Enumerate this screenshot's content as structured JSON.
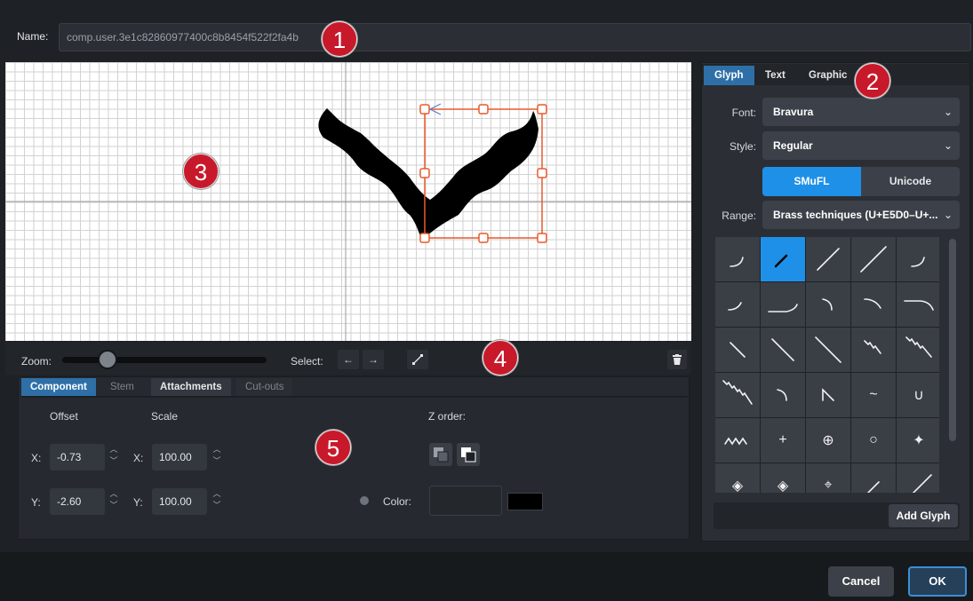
{
  "name": {
    "label": "Name:",
    "value": "comp.user.3e1c82860977400c8b8454f522f2fa4b"
  },
  "zoom": {
    "label": "Zoom:",
    "level": 0.22
  },
  "select": {
    "label": "Select:",
    "prev": "←",
    "next": "→"
  },
  "component_tabs": [
    "Component",
    "Stem",
    "Attachments",
    "Cut-outs"
  ],
  "offset": {
    "title": "Offset",
    "x_label": "X:",
    "x": "-0.73",
    "y_label": "Y:",
    "y": "-2.60"
  },
  "scale": {
    "title": "Scale",
    "x_label": "X:",
    "x": "100.00",
    "y_label": "Y:",
    "y": "100.00"
  },
  "zorder": {
    "label": "Z order:"
  },
  "color": {
    "label": "Color:",
    "value": "#000000"
  },
  "right_tabs": [
    "Glyph",
    "Text",
    "Graphic"
  ],
  "font": {
    "label": "Font:",
    "value": "Bravura"
  },
  "style": {
    "label": "Style:",
    "value": "Regular"
  },
  "encoding": {
    "smufl": "SMuFL",
    "unicode": "Unicode"
  },
  "range": {
    "label": "Range:",
    "value": "Brass techniques (U+E5D0–U+..."
  },
  "add_glyph": "Add Glyph",
  "buttons": {
    "cancel": "Cancel",
    "ok": "OK"
  },
  "callouts": [
    "1",
    "2",
    "3",
    "4",
    "5"
  ],
  "glyph_cells": [
    {
      "icon": "scoop-icon",
      "glyph": ""
    },
    {
      "icon": "doit-short-icon",
      "glyph": "",
      "selected": true
    },
    {
      "icon": "doit-medium-icon",
      "glyph": ""
    },
    {
      "icon": "doit-long-icon",
      "glyph": ""
    },
    {
      "icon": "lift-short-icon",
      "glyph": ""
    },
    {
      "icon": "lift-icon",
      "glyph": ""
    },
    {
      "icon": "lift-long-icon",
      "glyph": ""
    },
    {
      "icon": "plop-icon",
      "glyph": ""
    },
    {
      "icon": "falloff-icon",
      "glyph": ""
    },
    {
      "icon": "falloff-long-icon",
      "glyph": ""
    },
    {
      "icon": "fall-short-icon",
      "glyph": ""
    },
    {
      "icon": "fall-medium-icon",
      "glyph": ""
    },
    {
      "icon": "fall-long-icon",
      "glyph": ""
    },
    {
      "icon": "fall-rough-icon",
      "glyph": ""
    },
    {
      "icon": "fall-rough-long-icon",
      "glyph": ""
    },
    {
      "icon": "fall-rough-xlong-icon",
      "glyph": ""
    },
    {
      "icon": "bend-icon",
      "glyph": ""
    },
    {
      "icon": "flip-icon",
      "glyph": ""
    },
    {
      "icon": "smear-icon",
      "glyph": "~"
    },
    {
      "icon": "mute-bowl-icon",
      "glyph": "∪"
    },
    {
      "icon": "shake-icon",
      "glyph": ""
    },
    {
      "icon": "plus-icon",
      "glyph": "+"
    },
    {
      "icon": "half-mute-icon",
      "glyph": "⊕"
    },
    {
      "icon": "open-circle-icon",
      "glyph": "○"
    },
    {
      "icon": "harmon-icon",
      "glyph": "✦"
    },
    {
      "icon": "harmon-closed-icon",
      "glyph": "◈"
    },
    {
      "icon": "harmon-half-icon",
      "glyph": "◈"
    },
    {
      "icon": "harmon-open-icon",
      "glyph": "⌖"
    },
    {
      "icon": "slash-short-icon",
      "glyph": ""
    },
    {
      "icon": "slash-long-icon",
      "glyph": ""
    }
  ]
}
